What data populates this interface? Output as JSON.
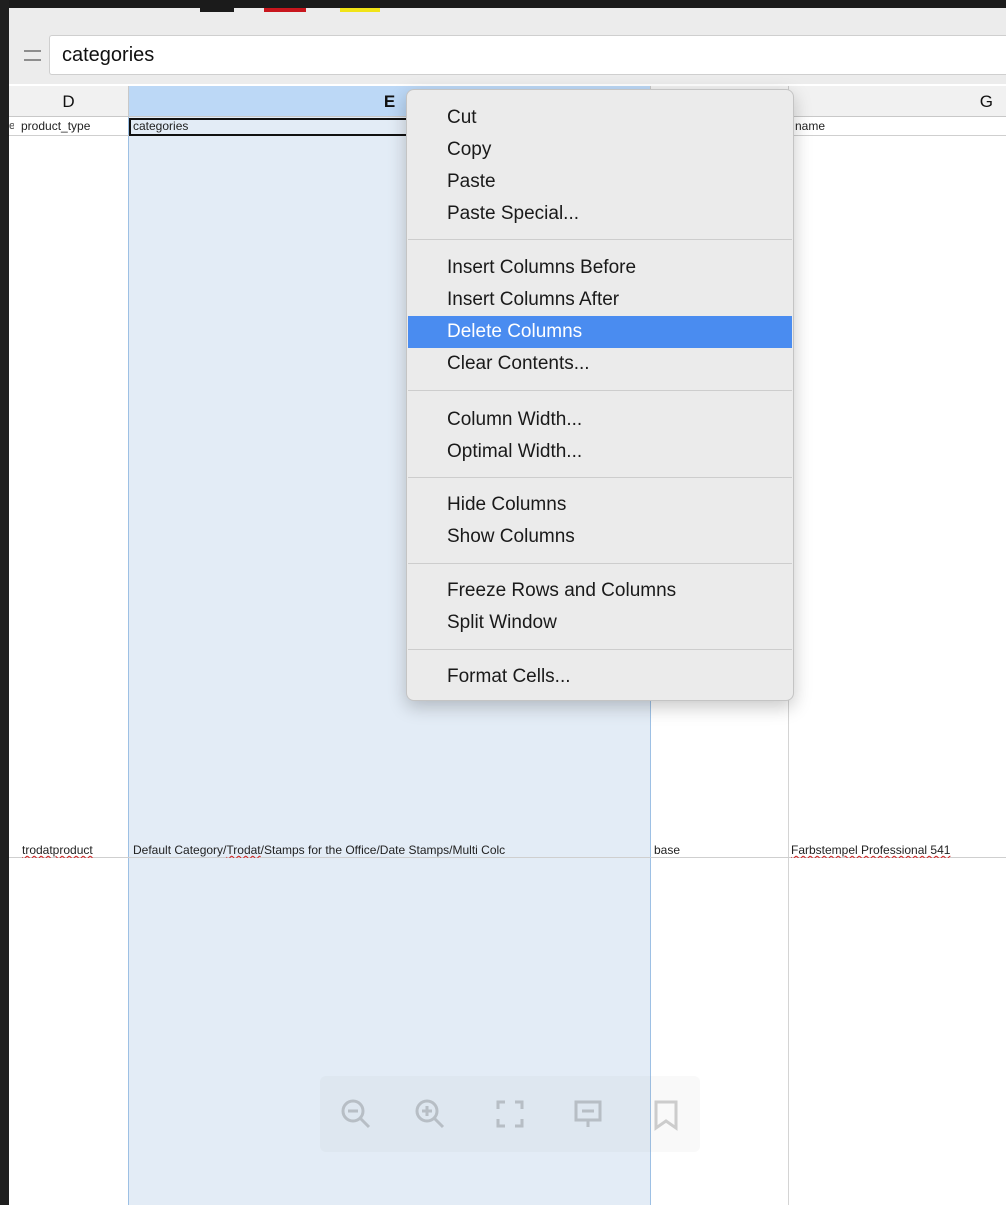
{
  "formula_bar": {
    "content": "categories"
  },
  "columns": [
    {
      "letter": "D"
    },
    {
      "letter": "E"
    },
    {
      "letter": ""
    },
    {
      "letter": "G"
    }
  ],
  "rows": [
    {
      "d": "product_type",
      "e": "categories",
      "f": "",
      "g": "name"
    },
    {
      "d": "trodatproduct",
      "e": "Default Category/Trodat/Stamps for the Office/Date Stamps/Multi Colc",
      "f": "base",
      "g": "Farbstempel Professional 541"
    }
  ],
  "prev_column_cut": "e",
  "context_menu": {
    "items": [
      {
        "label": "Cut"
      },
      {
        "label": "Copy"
      },
      {
        "label": "Paste"
      },
      {
        "label": "Paste Special..."
      },
      {
        "label": "Insert Columns Before"
      },
      {
        "label": "Insert Columns After"
      },
      {
        "label": "Delete Columns",
        "highlighted": true
      },
      {
        "label": "Clear Contents..."
      },
      {
        "label": "Column Width..."
      },
      {
        "label": "Optimal Width..."
      },
      {
        "label": "Hide Columns"
      },
      {
        "label": "Show Columns"
      },
      {
        "label": "Freeze Rows and Columns"
      },
      {
        "label": "Split Window"
      },
      {
        "label": "Format Cells..."
      }
    ]
  },
  "zoom_toolbar": {
    "icons": [
      "zoom-out-icon",
      "zoom-in-icon",
      "fit-page-icon",
      "presentation-icon",
      "comment-icon"
    ]
  },
  "colors": {
    "selection": "#bcd8f6",
    "menu_highlight": "#4a8cf0",
    "swatch_red": "#c8161d",
    "swatch_yellow": "#f1e418"
  }
}
